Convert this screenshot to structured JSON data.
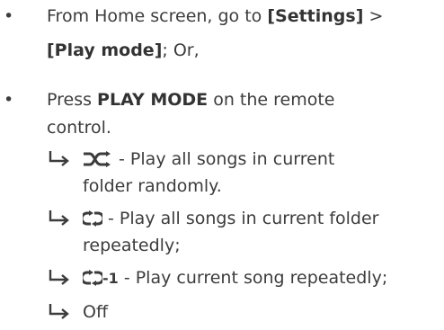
{
  "bullets": [
    {
      "segments": [
        {
          "text": "From Home screen, go to ",
          "bold": false
        },
        {
          "text": "[Settings]",
          "bold": true
        },
        {
          "text": " >",
          "bold": false
        }
      ],
      "line2": [
        {
          "text": "[Play mode]",
          "bold": true
        },
        {
          "text": "; Or,",
          "bold": false
        }
      ]
    },
    {
      "line1": [
        {
          "text": "Press ",
          "bold": false
        },
        {
          "text": "PLAY MODE",
          "bold": true
        },
        {
          "text": " on the remote",
          "bold": false
        }
      ],
      "line2": "control."
    }
  ],
  "sub_items": [
    {
      "icon": "shuffle-icon",
      "line1": " - Play all songs in current",
      "line2": "folder randomly."
    },
    {
      "icon": "repeat-all-icon",
      "line1": " - Play all songs in current folder",
      "line2": "repeatedly;"
    },
    {
      "icon": "repeat-one-icon",
      "icon_label": "-1",
      "line1": " - Play current song repeatedly;"
    },
    {
      "line1": "Off"
    }
  ],
  "bullet_char": "•",
  "text_color": "#3c3c3c"
}
